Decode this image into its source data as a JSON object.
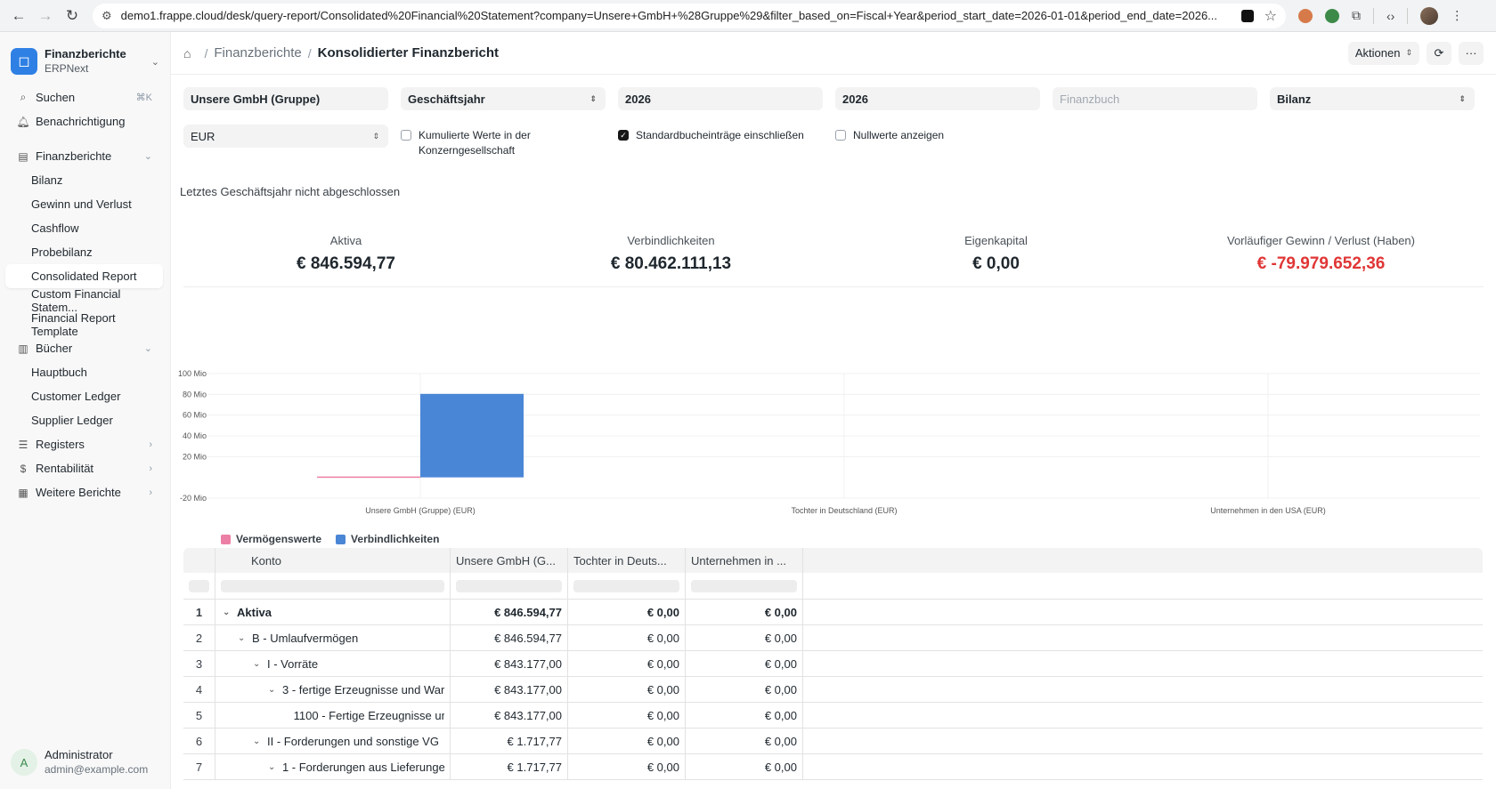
{
  "browser": {
    "url": "demo1.frappe.cloud/desk/query-report/Consolidated%20Financial%20Statement?company=Unsere+GmbH+%28Gruppe%29&filter_based_on=Fiscal+Year&period_start_date=2026-01-01&period_end_date=2026..."
  },
  "workspace": {
    "title": "Finanzberichte",
    "subtitle": "ERPNext"
  },
  "sidebar": {
    "search_label": "Suchen",
    "search_shortcut": "⌘K",
    "notification_label": "Benachrichtigung",
    "section_finance": "Finanzberichte",
    "finance_items": [
      "Bilanz",
      "Gewinn und Verlust",
      "Cashflow",
      "Probebilanz",
      "Consolidated Report",
      "Custom Financial Statem...",
      "Financial Report Template"
    ],
    "section_books": "Bücher",
    "book_items": [
      "Hauptbuch",
      "Customer Ledger",
      "Supplier Ledger"
    ],
    "registers": "Registers",
    "rentabilitaet": "Rentabilität",
    "weitere": "Weitere Berichte",
    "user_initial": "A",
    "user_name": "Administrator",
    "user_email": "admin@example.com"
  },
  "header": {
    "breadcrumb_parent": "Finanzberichte",
    "breadcrumb_current": "Konsolidierter Finanzbericht",
    "actions_label": "Aktionen"
  },
  "filters": {
    "company": "Unsere GmbH (Gruppe)",
    "based_on": "Geschäftsjahr",
    "from_year": "2026",
    "to_year": "2026",
    "finance_book_placeholder": "Finanzbuch",
    "report": "Bilanz",
    "currency": "EUR",
    "accumulated_label": "Kumulierte Werte in der Konzerngesellschaft",
    "accumulated_checked": false,
    "include_default_label": "Standardbucheinträge einschließen",
    "include_default_checked": true,
    "show_zero_label": "Nullwerte anzeigen",
    "show_zero_checked": false
  },
  "note": "Letztes Geschäftsjahr nicht abgeschlossen",
  "summary": [
    {
      "label": "Aktiva",
      "value": "€ 846.594,77"
    },
    {
      "label": "Verbindlichkeiten",
      "value": "€ 80.462.111,13"
    },
    {
      "label": "Eigenkapital",
      "value": "€ 0,00"
    },
    {
      "label": "Vorläufiger Gewinn / Verlust (Haben)",
      "value": "€ -79.979.652,36"
    }
  ],
  "colors": {
    "assets": "#ec7fa5",
    "liabilities": "#4a86d6",
    "negative": "#e03636"
  },
  "chart_data": {
    "type": "bar",
    "categories": [
      "Unsere GmbH (Gruppe) (EUR)",
      "Tochter in Deutschland (EUR)",
      "Unternehmen in den USA (EUR)"
    ],
    "series": [
      {
        "name": "Vermögenswerte",
        "values": [
          0.85,
          0,
          0
        ]
      },
      {
        "name": "Verbindlichkeiten",
        "values": [
          80.46,
          0,
          0
        ]
      }
    ],
    "yticks": [
      "100 Mio",
      "80 Mio",
      "60 Mio",
      "40 Mio",
      "20 Mio",
      "-20 Mio"
    ],
    "ytick_values": [
      100,
      80,
      60,
      40,
      20,
      -20
    ],
    "ylim": [
      -20,
      100
    ],
    "legend_position": "bottom-left"
  },
  "table": {
    "columns": [
      "Konto",
      "Unsere GmbH (G...",
      "Tochter in Deuts...",
      "Unternehmen in ..."
    ],
    "rows": [
      {
        "n": "1",
        "depth": 0,
        "chevron": true,
        "bold": true,
        "account": "Aktiva",
        "v1": "€ 846.594,77",
        "v2": "€ 0,00",
        "v3": "€ 0,00"
      },
      {
        "n": "2",
        "depth": 1,
        "chevron": true,
        "bold": false,
        "account": "B - Umlaufvermögen",
        "v1": "€ 846.594,77",
        "v2": "€ 0,00",
        "v3": "€ 0,00"
      },
      {
        "n": "3",
        "depth": 2,
        "chevron": true,
        "bold": false,
        "account": "I - Vorräte",
        "v1": "€ 843.177,00",
        "v2": "€ 0,00",
        "v3": "€ 0,00"
      },
      {
        "n": "4",
        "depth": 3,
        "chevron": true,
        "bold": false,
        "account": "3 - fertige Erzeugnisse und War",
        "v1": "€ 843.177,00",
        "v2": "€ 0,00",
        "v3": "€ 0,00"
      },
      {
        "n": "5",
        "depth": 4,
        "chevron": false,
        "bold": false,
        "account": "1100 - Fertige Erzeugnisse unc",
        "v1": "€ 843.177,00",
        "v2": "€ 0,00",
        "v3": "€ 0,00"
      },
      {
        "n": "6",
        "depth": 2,
        "chevron": true,
        "bold": false,
        "account": "II - Forderungen und sonstige VG",
        "v1": "€ 1.717,77",
        "v2": "€ 0,00",
        "v3": "€ 0,00"
      },
      {
        "n": "7",
        "depth": 3,
        "chevron": true,
        "bold": false,
        "account": "1 - Forderungen aus Lieferunge",
        "v1": "€ 1.717,77",
        "v2": "€ 0,00",
        "v3": "€ 0,00"
      }
    ]
  }
}
